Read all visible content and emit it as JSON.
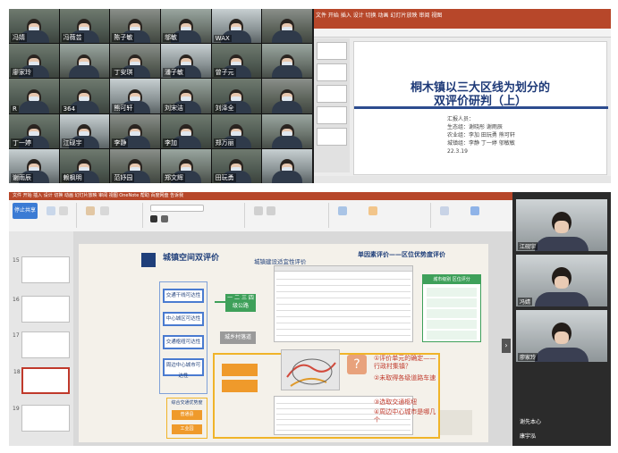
{
  "meeting_grid": {
    "tiles": [
      "冯婧",
      "冯薇芸",
      "陈子敏",
      "邬敏",
      "WAX",
      "",
      "廖家玲",
      "",
      "丁安琪",
      "潘子敏",
      "曾子元",
      "",
      "R",
      "364",
      "熊可轩",
      "刘宋洁",
      "刘泽全",
      "",
      "丁一婷",
      "江砚宇",
      "李静",
      "李加",
      "郑万丽",
      "",
      "谢雨辰",
      "赖枫明",
      "范妤园",
      "郑文辉",
      "田玩勇",
      ""
    ]
  },
  "title_slide": {
    "ribbon_tabs": "文件 开始 插入 设计 切换 动画 幻灯片放映 审阅 视图",
    "title_line1": "桐木镇以三大区线为划分的",
    "title_line2": "双评价研判（上）",
    "reporters_label": "汇报人员：",
    "group1": "生态组：谢晓彤 谢雨辰",
    "group2": "农业组：李加 田玩勇 熊可轩",
    "group3": "城镇组：李静 丁一婷 邬敏敏",
    "date": "22.3.19"
  },
  "editor": {
    "share_button": "停止共享",
    "ribbon_tabs": "文件 开始 插入 设计 切换 动画 幻灯片放映 审阅 视图 OneNote 帮助 百度网盘 告诉我",
    "slide_numbers": [
      "15",
      "16",
      "17",
      "18",
      "19"
    ],
    "slide": {
      "title": "城镇空间双评价",
      "subtitle": "城镇建设适宜性评价",
      "right_title": "单因素评价——区位优势度评价",
      "left_boxes": [
        "交通干线可达性",
        "中心城区可达性",
        "交通枢纽可达性",
        "周边中心城市可达性"
      ],
      "green_box_label": "一 二 三 四\n级公路",
      "grey_box": "城乡村落道",
      "orange_boxes": [
        "",
        ""
      ],
      "bottom_boxes": [
        "综合交通优势度",
        "普通县",
        "工业园"
      ],
      "right_table_header": "城市级别 区位评分",
      "right_table_rows": [
        [
          "一",
          "一"
        ],
        [
          "二",
          "二"
        ],
        [
          "三",
          "三"
        ],
        [
          "四",
          "四"
        ],
        [
          "五",
          "五"
        ]
      ],
      "questions": [
        "①评价单元的确定——行政村集镇？",
        "②未取得各级道路车速",
        "③选取交通枢纽",
        "④周边中心城市是哪几个"
      ],
      "question_mark": "?"
    }
  },
  "side_videos": [
    {
      "name": "江砚宇"
    },
    {
      "name": "冯婧"
    },
    {
      "name": "廖家玲"
    }
  ],
  "side_names": [
    "谢先本心",
    "康宇泓"
  ]
}
